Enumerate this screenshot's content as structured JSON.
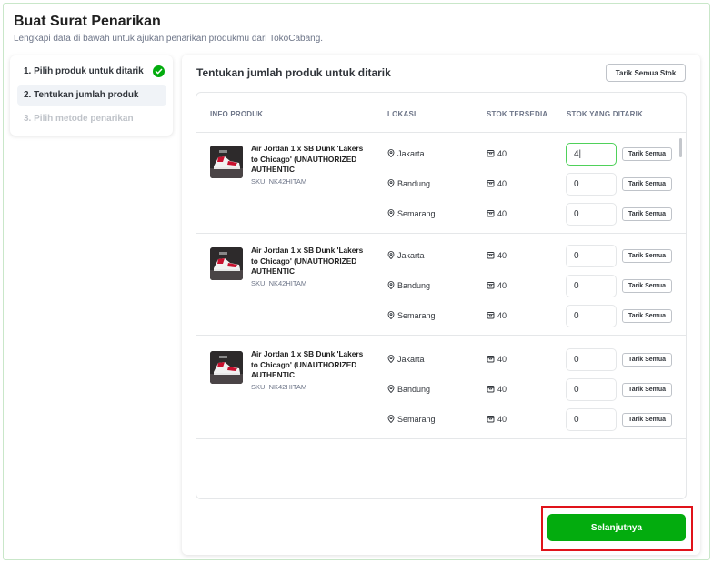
{
  "page": {
    "title": "Buat Surat Penarikan",
    "subtitle": "Lengkapi data di bawah untuk ajukan penarikan produkmu dari TokoCabang."
  },
  "steps": [
    {
      "label": "1. Pilih produk untuk ditarik",
      "state": "completed"
    },
    {
      "label": "2. Tentukan jumlah produk",
      "state": "active"
    },
    {
      "label": "3. Pilih metode penarikan",
      "state": "disabled"
    }
  ],
  "main": {
    "title": "Tentukan jumlah produk untuk ditarik",
    "tarik_semua_stok_label": "Tarik Semua Stok"
  },
  "table": {
    "headers": [
      "INFO PRODUK",
      "LOKASI",
      "STOK TERSEDIA",
      "STOK YANG DITARIK"
    ],
    "row_button_label": "Tarik Semua",
    "groups": [
      {
        "product_name": "Air Jordan 1 x SB Dunk 'Lakers to Chicago' (UNAUTHORIZED AUTHENTIC",
        "sku": "SKU: NK42HITAM",
        "rows": [
          {
            "location": "Jakarta",
            "stock": "40",
            "qty": "4|"
          },
          {
            "location": "Bandung",
            "stock": "40",
            "qty": "0"
          },
          {
            "location": "Semarang",
            "stock": "40",
            "qty": "0"
          }
        ]
      },
      {
        "product_name": "Air Jordan 1 x SB Dunk 'Lakers to Chicago' (UNAUTHORIZED AUTHENTIC",
        "sku": "SKU: NK42HITAM",
        "rows": [
          {
            "location": "Jakarta",
            "stock": "40",
            "qty": "0"
          },
          {
            "location": "Bandung",
            "stock": "40",
            "qty": "0"
          },
          {
            "location": "Semarang",
            "stock": "40",
            "qty": "0"
          }
        ]
      },
      {
        "product_name": "Air Jordan 1 x SB Dunk 'Lakers to Chicago' (UNAUTHORIZED AUTHENTIC",
        "sku": "SKU: NK42HITAM",
        "rows": [
          {
            "location": "Jakarta",
            "stock": "40",
            "qty": "0"
          },
          {
            "location": "Bandung",
            "stock": "40",
            "qty": "0"
          },
          {
            "location": "Semarang",
            "stock": "40",
            "qty": "0"
          }
        ]
      }
    ]
  },
  "footer": {
    "next_label": "Selanjutnya"
  },
  "colors": {
    "primary": "#03ac0e",
    "highlight": "#e0131a",
    "focus": "#4fd15a"
  },
  "icons": [
    "check-icon",
    "location-pin-icon",
    "stock-box-icon",
    "product-thumbnail"
  ]
}
